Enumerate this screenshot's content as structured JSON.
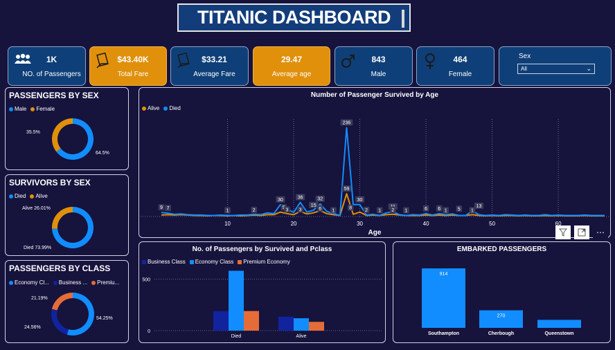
{
  "title": "TITANIC DASHBOARD",
  "kpis": [
    {
      "value": "1K",
      "label": "NO. of Passengers",
      "icon": "people-icon"
    },
    {
      "value": "$43.40K",
      "label": "Total Fare",
      "icon": "money-icon"
    },
    {
      "value": "$33.21",
      "label": "Average Fare",
      "icon": "money-icon"
    },
    {
      "value": "29.47",
      "label": "Average age",
      "icon": ""
    },
    {
      "value": "843",
      "label": "Male",
      "icon": "male-icon"
    },
    {
      "value": "464",
      "label": "Female",
      "icon": "female-icon"
    }
  ],
  "slicer": {
    "label": "Sex",
    "selected": "All"
  },
  "colors": {
    "blue": "#118dff",
    "navy": "#12239e",
    "orange": "#e0900b",
    "coral": "#e66c37",
    "bg": "#16133d"
  },
  "chart_data": [
    {
      "type": "pie",
      "title": "PASSENGERS BY SEX",
      "legend": [
        "Male",
        "Female"
      ],
      "values": [
        64.5,
        35.5
      ],
      "labels": [
        "64.5%",
        "35.5%"
      ]
    },
    {
      "type": "pie",
      "title": "SURVIVORS BY SEX",
      "legend": [
        "Died",
        "Alive"
      ],
      "values": [
        73.99,
        26.01
      ],
      "labels": [
        "Died 73.99%",
        "Alive 26.01%"
      ]
    },
    {
      "type": "pie",
      "title": "PASSENGERS BY CLASS",
      "legend": [
        "Economy Cl...",
        "Business ...",
        "Premiu..."
      ],
      "values": [
        54.25,
        24.56,
        21.19
      ],
      "labels": [
        "54.25%",
        "24.56%",
        "21.19%"
      ]
    },
    {
      "type": "line",
      "title": "Number of Passenger Survived by Age",
      "xlabel": "Age",
      "xticks": [
        10,
        20,
        30,
        40,
        50,
        60
      ],
      "xlim": [
        0,
        67
      ],
      "ylim": [
        0,
        250
      ],
      "legend": [
        "Alive",
        "Died"
      ],
      "series": [
        {
          "name": "Died",
          "x": [
            0,
            1,
            2,
            3,
            4,
            5,
            6,
            7,
            8,
            9,
            10,
            11,
            12,
            13,
            14,
            15,
            16,
            17,
            18,
            19,
            20,
            21,
            22,
            23,
            24,
            25,
            26,
            27,
            28,
            29,
            30,
            31,
            32,
            33,
            34,
            35,
            36,
            37,
            38,
            39,
            40,
            41,
            42,
            43,
            44,
            45,
            46,
            47,
            48,
            49,
            50,
            51,
            52,
            53,
            54,
            55,
            56,
            57,
            58,
            59,
            60,
            61,
            62,
            63,
            64,
            65,
            66,
            67
          ],
          "y": [
            9,
            7,
            4,
            5,
            3,
            2,
            2,
            1,
            1,
            2,
            1,
            1,
            2,
            2,
            4,
            3,
            8,
            6,
            30,
            18,
            9,
            36,
            10,
            15,
            32,
            12,
            6,
            1,
            236,
            30,
            30,
            2,
            4,
            1,
            8,
            11,
            3,
            1,
            3,
            2,
            6,
            2,
            6,
            3,
            5,
            1,
            1,
            13,
            3,
            1,
            2,
            1,
            3,
            2,
            1,
            2,
            1,
            1,
            3,
            1,
            2,
            1,
            1,
            1,
            2,
            1,
            1,
            1
          ]
        },
        {
          "name": "Alive",
          "x": [
            0,
            1,
            2,
            3,
            4,
            5,
            6,
            7,
            8,
            9,
            10,
            11,
            12,
            13,
            14,
            15,
            16,
            17,
            18,
            19,
            20,
            21,
            22,
            23,
            24,
            25,
            26,
            27,
            28,
            29,
            30,
            31,
            32,
            33,
            34,
            35,
            36,
            37,
            38,
            39,
            40,
            41,
            42,
            43,
            44,
            45,
            46,
            47,
            48,
            49,
            50,
            51,
            52,
            53,
            54,
            55,
            56,
            57,
            58,
            59,
            60,
            61,
            62,
            63,
            64,
            65,
            66,
            67
          ],
          "y": [
            2,
            3,
            2,
            3,
            2,
            1,
            1,
            0,
            1,
            1,
            0,
            1,
            0,
            1,
            2,
            1,
            3,
            3,
            10,
            6,
            3,
            12,
            5,
            8,
            14,
            6,
            3,
            1,
            59,
            4,
            10,
            1,
            2,
            1,
            3,
            4,
            2,
            1,
            1,
            1,
            2,
            1,
            2,
            1,
            2,
            1,
            1,
            3,
            1,
            0,
            1,
            0,
            1,
            1,
            0,
            1,
            0,
            0,
            1,
            0,
            1,
            0,
            0,
            0,
            1,
            0,
            0,
            0
          ]
        }
      ],
      "data_labels": [
        {
          "x": 0,
          "y": 9,
          "text": "9"
        },
        {
          "x": 1,
          "y": 7,
          "text": "7"
        },
        {
          "x": 10,
          "y": 1,
          "text": "1"
        },
        {
          "x": 14,
          "y": 2,
          "text": "2"
        },
        {
          "x": 18,
          "y": 30,
          "text": "30"
        },
        {
          "x": 18.5,
          "y": 9,
          "text": "9"
        },
        {
          "x": 19,
          "y": 3,
          "text": "3"
        },
        {
          "x": 21,
          "y": 36,
          "text": "36"
        },
        {
          "x": 21,
          "y": 3,
          "text": "3"
        },
        {
          "x": 23,
          "y": 15,
          "text": "15"
        },
        {
          "x": 24,
          "y": 32,
          "text": "32"
        },
        {
          "x": 24,
          "y": 6,
          "text": "6"
        },
        {
          "x": 26,
          "y": 1,
          "text": "1"
        },
        {
          "x": 28,
          "y": 236,
          "text": "236"
        },
        {
          "x": 28,
          "y": 59,
          "text": "59"
        },
        {
          "x": 28.6,
          "y": 8,
          "text": "8"
        },
        {
          "x": 30,
          "y": 30,
          "text": "30"
        },
        {
          "x": 31,
          "y": 2,
          "text": "2"
        },
        {
          "x": 33,
          "y": 1,
          "text": "1"
        },
        {
          "x": 35,
          "y": 11,
          "text": "11"
        },
        {
          "x": 35,
          "y": 2,
          "text": "2"
        },
        {
          "x": 37,
          "y": 1,
          "text": "1"
        },
        {
          "x": 40,
          "y": 6,
          "text": "6"
        },
        {
          "x": 42,
          "y": 6,
          "text": "6"
        },
        {
          "x": 43,
          "y": 1,
          "text": "1"
        },
        {
          "x": 45,
          "y": 5,
          "text": "5"
        },
        {
          "x": 47,
          "y": 1,
          "text": "1"
        },
        {
          "x": 48,
          "y": 13,
          "text": "13"
        }
      ]
    },
    {
      "type": "bar",
      "title": "No. of Passengers by Survived and Pclass",
      "categories": [
        "Died",
        "Alive"
      ],
      "yticks": [
        0,
        500
      ],
      "ylim": [
        0,
        650
      ],
      "series": [
        {
          "name": "Business Class",
          "values": [
            190,
            135
          ]
        },
        {
          "name": "Economy Class",
          "values": [
            580,
            120
          ]
        },
        {
          "name": "Premium Economy",
          "values": [
            190,
            85
          ]
        }
      ]
    },
    {
      "type": "bar",
      "title": "EMBARKED PASSENGERS",
      "categories": [
        "Southampton",
        "Cherbough",
        "Queenstown"
      ],
      "values": [
        914,
        270,
        123
      ],
      "data_labels": [
        "914",
        "270",
        ""
      ],
      "ylim": [
        0,
        914
      ]
    }
  ]
}
